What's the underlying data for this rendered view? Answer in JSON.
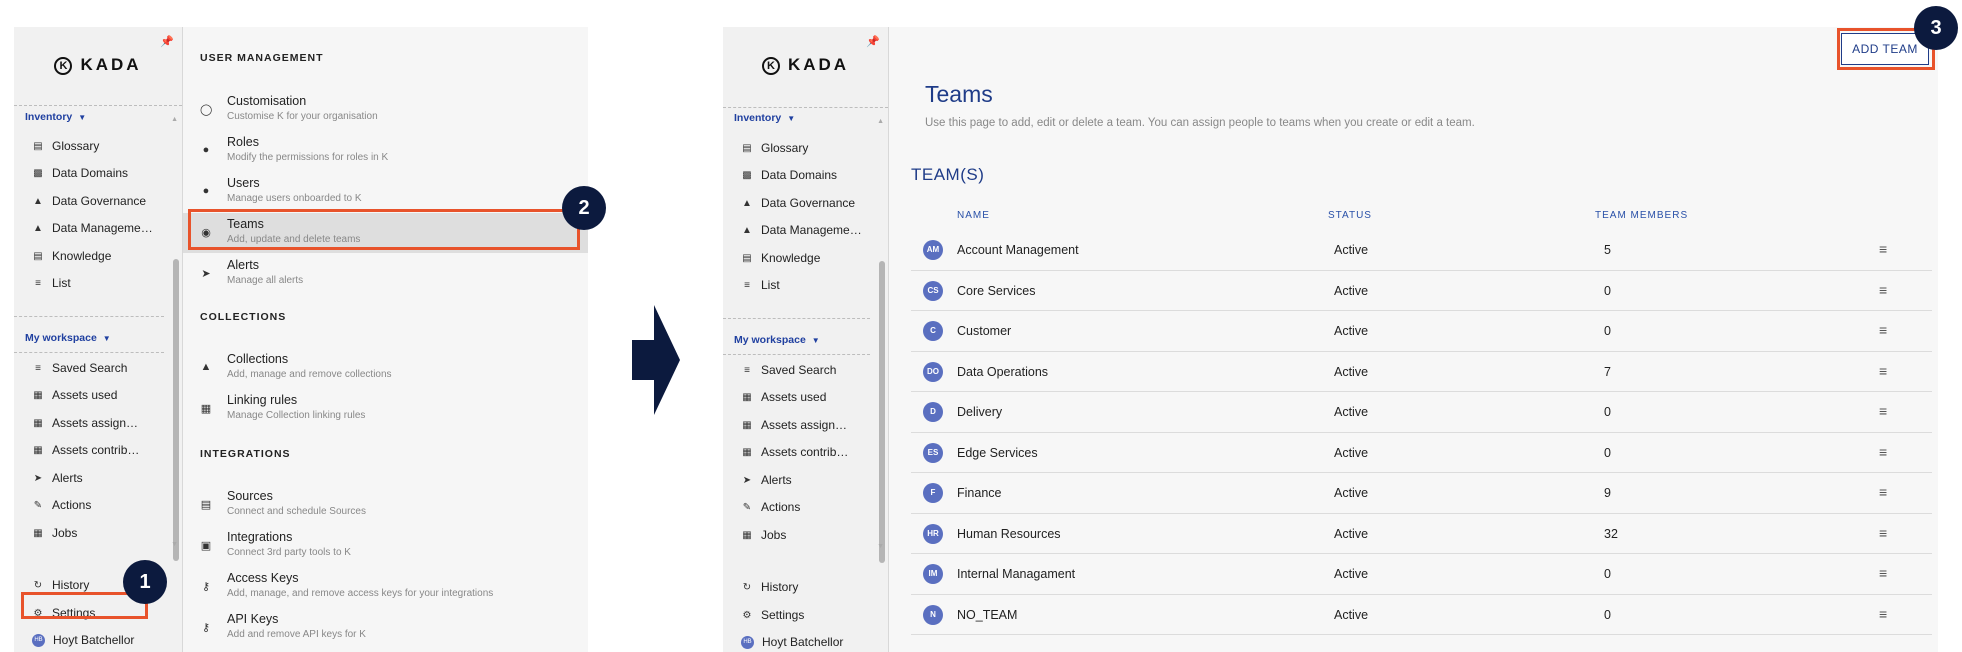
{
  "brand": "KADA",
  "left_sidebar": {
    "sections": [
      {
        "label": "Inventory",
        "items": [
          {
            "label": "Glossary",
            "icon": "book-icon"
          },
          {
            "label": "Data Domains",
            "icon": "building-icon"
          },
          {
            "label": "Data Governance",
            "icon": "hierarchy-icon"
          },
          {
            "label": "Data Manageme…",
            "icon": "hierarchy-icon"
          },
          {
            "label": "Knowledge",
            "icon": "document-icon"
          },
          {
            "label": "List",
            "icon": "list-icon"
          }
        ]
      },
      {
        "label": "My workspace",
        "items": [
          {
            "label": "Saved Search",
            "icon": "filter-icon"
          },
          {
            "label": "Assets used",
            "icon": "table-icon"
          },
          {
            "label": "Assets assign…",
            "icon": "table-icon"
          },
          {
            "label": "Assets contrib…",
            "icon": "table-icon"
          },
          {
            "label": "Alerts",
            "icon": "send-icon"
          },
          {
            "label": "Actions",
            "icon": "pencil-icon"
          },
          {
            "label": "Jobs",
            "icon": "grid-icon"
          }
        ]
      }
    ],
    "footer": [
      {
        "label": "History",
        "icon": "history-icon"
      },
      {
        "label": "Settings",
        "icon": "gear-icon"
      },
      {
        "label": "Hoyt Batchellor",
        "icon": "avatar",
        "initials": "HB"
      }
    ]
  },
  "settings_menu": {
    "groups": [
      {
        "heading": "USER MANAGEMENT",
        "items": [
          {
            "title": "Customisation",
            "subtitle": "Customise K for your organisation",
            "icon": "palette-icon"
          },
          {
            "title": "Roles",
            "subtitle": "Modify the permissions for roles in K",
            "icon": "user-key-icon"
          },
          {
            "title": "Users",
            "subtitle": "Manage users onboarded to K",
            "icon": "person-icon"
          },
          {
            "title": "Teams",
            "subtitle": "Add, update and delete teams",
            "icon": "team-icon"
          },
          {
            "title": "Alerts",
            "subtitle": "Manage all alerts",
            "icon": "send-icon"
          }
        ]
      },
      {
        "heading": "COLLECTIONS",
        "items": [
          {
            "title": "Collections",
            "subtitle": "Add, manage and remove collections",
            "icon": "hierarchy-icon"
          },
          {
            "title": "Linking rules",
            "subtitle": "Manage Collection linking rules",
            "icon": "link-rule-icon"
          }
        ]
      },
      {
        "heading": "INTEGRATIONS",
        "items": [
          {
            "title": "Sources",
            "subtitle": "Connect and schedule Sources",
            "icon": "server-icon"
          },
          {
            "title": "Integrations",
            "subtitle": "Connect 3rd party tools to K",
            "icon": "login-icon"
          },
          {
            "title": "Access Keys",
            "subtitle": "Add, manage, and remove access keys for your integrations",
            "icon": "key-icon"
          },
          {
            "title": "API Keys",
            "subtitle": "Add and remove API keys for K",
            "icon": "key-icon"
          }
        ]
      }
    ]
  },
  "steps": [
    "1",
    "2",
    "3"
  ],
  "teams_page": {
    "add_button": "ADD TEAM",
    "title": "Teams",
    "description": "Use this page to add, edit or delete a team. You can assign people to teams when you create or edit a team.",
    "section": "TEAM(S)",
    "columns": [
      "NAME",
      "STATUS",
      "TEAM MEMBERS"
    ],
    "rows": [
      {
        "initials": "AM",
        "name": "Account Management",
        "status": "Active",
        "members": "5"
      },
      {
        "initials": "CS",
        "name": "Core Services",
        "status": "Active",
        "members": "0"
      },
      {
        "initials": "C",
        "name": "Customer",
        "status": "Active",
        "members": "0"
      },
      {
        "initials": "DO",
        "name": "Data Operations",
        "status": "Active",
        "members": "7"
      },
      {
        "initials": "D",
        "name": "Delivery",
        "status": "Active",
        "members": "0"
      },
      {
        "initials": "ES",
        "name": "Edge Services",
        "status": "Active",
        "members": "0"
      },
      {
        "initials": "F",
        "name": "Finance",
        "status": "Active",
        "members": "9"
      },
      {
        "initials": "HR",
        "name": "Human Resources",
        "status": "Active",
        "members": "32"
      },
      {
        "initials": "IM",
        "name": "Internal Managament",
        "status": "Active",
        "members": "0"
      },
      {
        "initials": "N",
        "name": "NO_TEAM",
        "status": "Active",
        "members": "0"
      }
    ]
  },
  "colors": {
    "accent": "#1f3c88",
    "callout": "#e8532b",
    "badge": "#0c1a3e",
    "avatar": "#5a6fc0",
    "arrow": "#0c1a3e"
  }
}
